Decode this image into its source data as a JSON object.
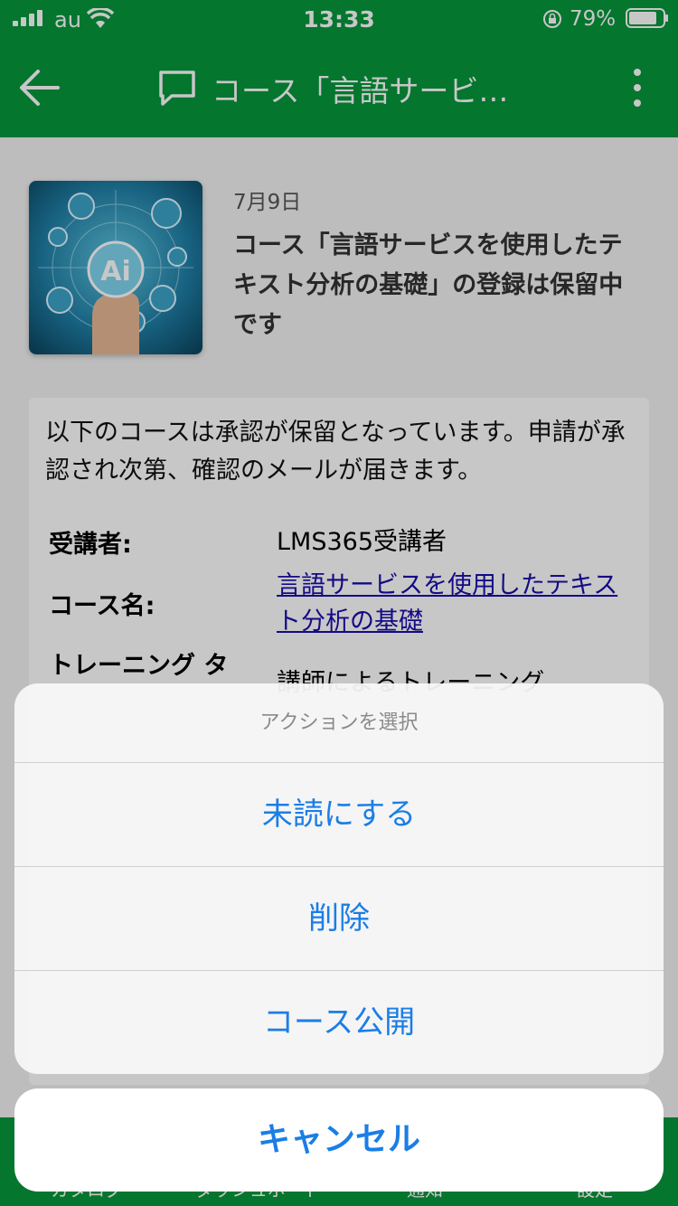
{
  "status_bar": {
    "carrier": "au",
    "time": "13:33",
    "battery_percent": "79%"
  },
  "nav": {
    "title": "コース「言語サービ…",
    "back_icon": "arrow-left-icon",
    "chat_icon": "chat-bubble-icon",
    "more_icon": "more-vertical-icon"
  },
  "notification": {
    "date": "7月9日",
    "title": "コース「言語サービスを使用したテキスト分析の基礎」の登録は保留中です",
    "thumbnail_text": "Ai"
  },
  "message": {
    "intro": "以下のコースは承認が保留となっています。申請が承認され次第、確認のメールが届きます。",
    "details": [
      {
        "label": "受講者:",
        "value": "LMS365受講者"
      },
      {
        "label": "コース名:",
        "value": "言語サービスを使用したテキスト分析の基礎"
      },
      {
        "label": "トレーニング タ",
        "value": "講師によるトレーニング"
      }
    ]
  },
  "tab_bar": {
    "items": [
      "カタログ",
      "ダッシュボード",
      "通知",
      "設定"
    ]
  },
  "action_sheet": {
    "title": "アクションを選択",
    "actions": [
      "未読にする",
      "削除",
      "コース公開"
    ],
    "cancel": "キャンセル"
  },
  "colors": {
    "brand_green": "#06983c",
    "action_blue": "#1a7ee6",
    "link_blue": "#1a0dab"
  }
}
